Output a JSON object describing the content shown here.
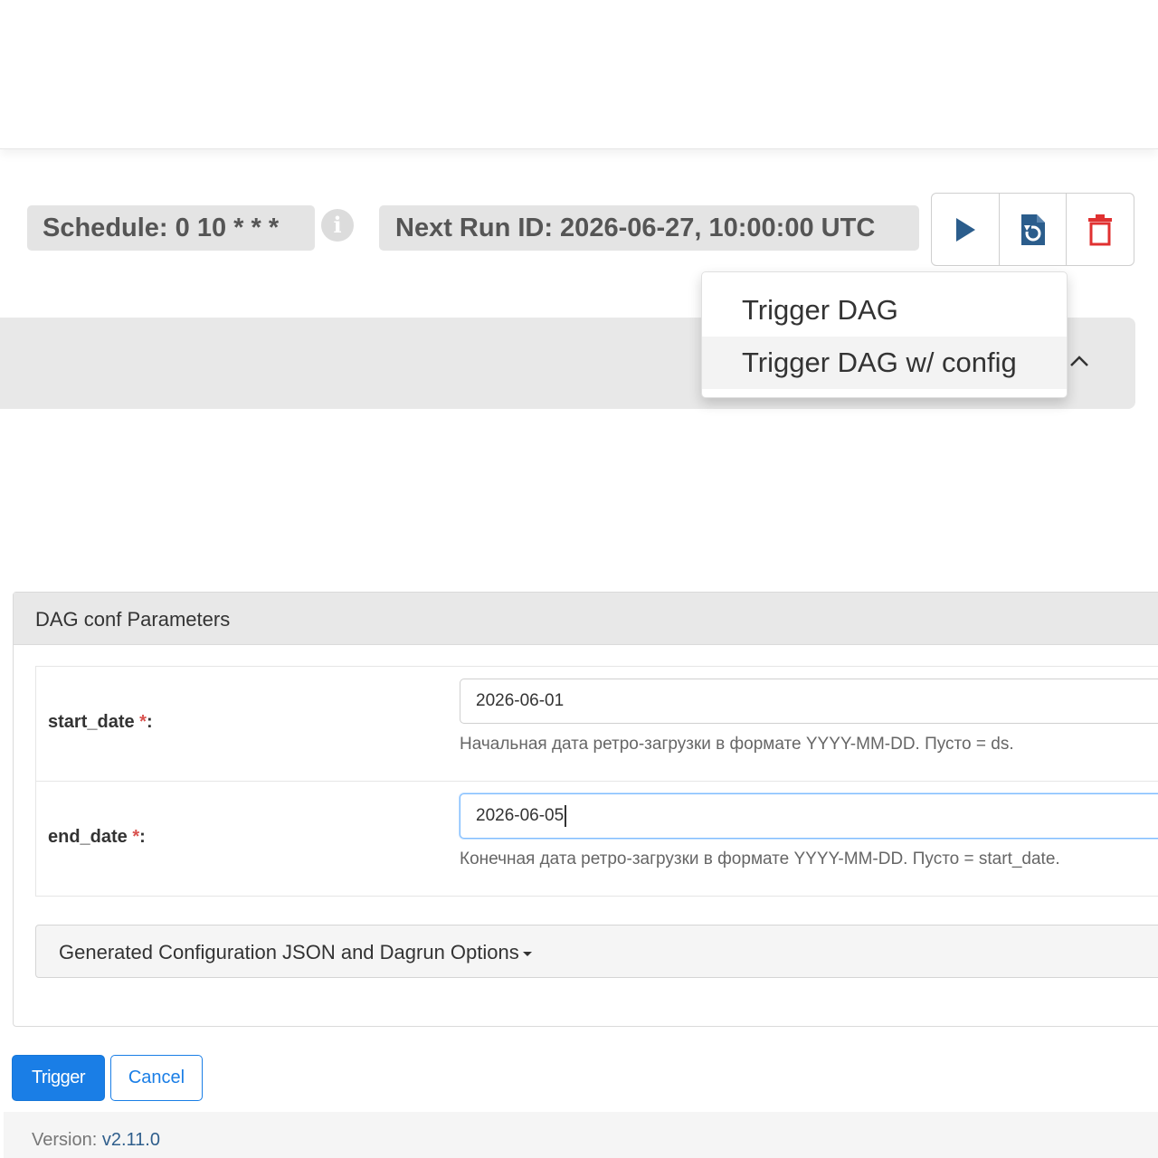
{
  "header": {
    "schedule_label": "Schedule: 0 10 * * *",
    "next_run_label": "Next Run ID: 2026-06-27, 10:00:00 UTC"
  },
  "actions": {
    "trigger_icon": "play-icon",
    "refresh_icon": "refresh-icon",
    "delete_icon": "trash-icon"
  },
  "dropdown": {
    "items": [
      {
        "label": "Trigger DAG"
      },
      {
        "label": "Trigger DAG w/ config"
      }
    ]
  },
  "conf": {
    "heading": "DAG conf Parameters",
    "params": [
      {
        "name": "start_date",
        "required_mark": "*",
        "colon": ":",
        "value": "2026-06-01",
        "help": "Начальная дата ретро-загрузки в формате YYYY-MM-DD. Пусто = ds."
      },
      {
        "name": "end_date",
        "required_mark": "*",
        "colon": ":",
        "value": "2026-06-05",
        "help": "Конечная дата ретро-загрузки в формате YYYY-MM-DD. Пусто = start_date."
      }
    ],
    "generated_label": "Generated Configuration JSON and Dagrun Options"
  },
  "buttons": {
    "trigger_label": "Trigger",
    "cancel_label": "Cancel"
  },
  "footer": {
    "version_label": "Version:",
    "version_value": "v2.11.0"
  },
  "colors": {
    "primary": "#1a7ee6",
    "play": "#2b5d8c",
    "danger": "#e03131",
    "required": "#d9534f"
  }
}
